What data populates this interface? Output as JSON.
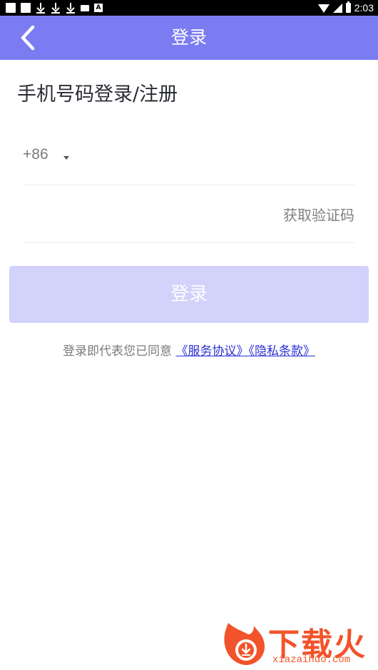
{
  "status_bar": {
    "time": "2:03",
    "mail_icon": "mail-icon",
    "a_badge": "A"
  },
  "app_bar": {
    "title": "登录",
    "back_icon": "chevron-left-icon",
    "color": "#7b7cf2"
  },
  "heading": "手机号码登录/注册",
  "phone": {
    "country_code": "+86",
    "value": ""
  },
  "code": {
    "value": "",
    "get_code_label": "获取验证码"
  },
  "login_button": {
    "label": "登录",
    "color": "#d2d2fa"
  },
  "agreement": {
    "prefix": "登录即代表您已同意",
    "service_link": "《服务协议》",
    "privacy_link": "《隐私条款》"
  },
  "watermark": {
    "brand": "下载火",
    "url": "xiazaihuo.com",
    "color": "#f2532a"
  }
}
